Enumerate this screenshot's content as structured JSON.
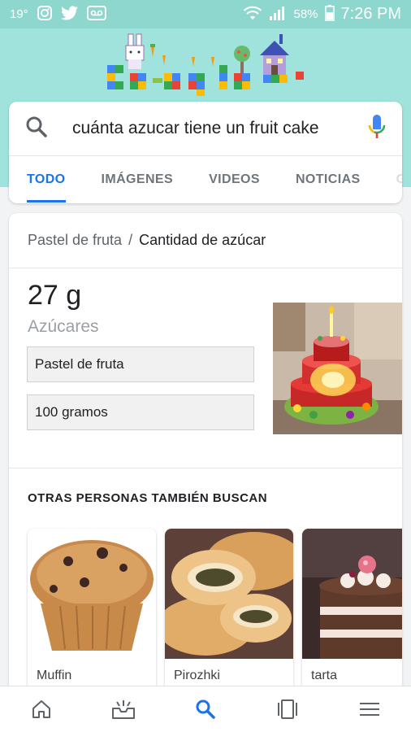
{
  "status_bar": {
    "temperature": "19°",
    "battery": "58%",
    "time": "7:26 PM"
  },
  "search": {
    "query": "cuánta azucar tiene un fruit cake"
  },
  "tabs": [
    {
      "label": "TODO",
      "active": true
    },
    {
      "label": "IMÁGENES",
      "active": false
    },
    {
      "label": "VIDEOS",
      "active": false
    },
    {
      "label": "NOTICIAS",
      "active": false
    },
    {
      "label": "GO",
      "active": false
    }
  ],
  "result": {
    "breadcrumb_parent": "Pastel de fruta",
    "breadcrumb_sep": "/",
    "breadcrumb_current": "Cantidad de azúcar",
    "value": "27 g",
    "value_label": "Azúcares",
    "food_select": "Pastel de fruta",
    "amount_select": "100 gramos"
  },
  "others": {
    "title": "OTRAS PERSONAS TAMBIÉN BUSCAN",
    "items": [
      {
        "label": "Muffin"
      },
      {
        "label": "Pirozhki"
      },
      {
        "label": "tarta"
      }
    ]
  },
  "bottom_nav": [
    "home-icon",
    "updates-icon",
    "search-icon",
    "tabs-icon",
    "menu-icon"
  ],
  "colors": {
    "accent": "#1a73e8",
    "teal": "#9fe3dc"
  }
}
